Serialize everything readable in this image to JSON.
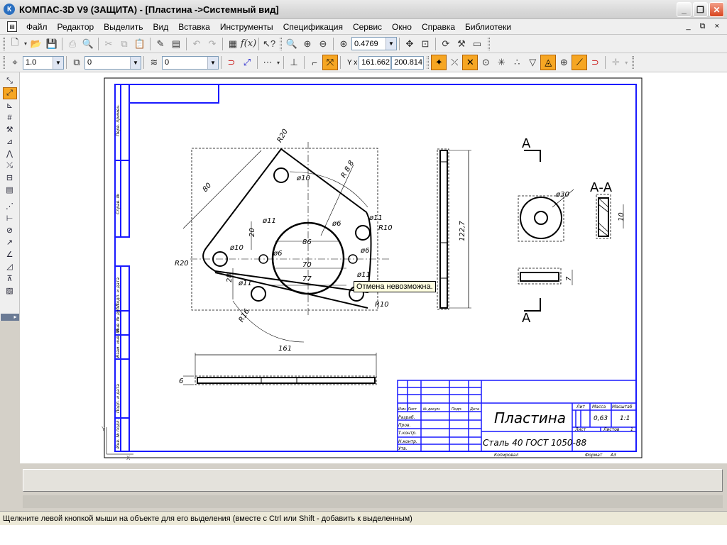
{
  "window": {
    "title": "КОМПАС-3D V9 (ЗАЩИТА) - [Пластина ->Системный вид]",
    "app_icon": "kompas-logo",
    "controls": [
      "minimize",
      "maximize",
      "close"
    ]
  },
  "menu": {
    "items": [
      "Файл",
      "Редактор",
      "Выделить",
      "Вид",
      "Вставка",
      "Инструменты",
      "Спецификация",
      "Сервис",
      "Окно",
      "Справка",
      "Библиотеки"
    ],
    "mdi_controls": "_ ⧉ ×"
  },
  "toolbar_standard": {
    "zoom_value": "0.4769"
  },
  "toolbar_current_state": {
    "step_value": "1.0",
    "layer_value": "0",
    "view_value": "0",
    "coord_label": "Y x",
    "coord_x": "161.662",
    "coord_y": "200.814"
  },
  "tooltip": "Отмена невозможна.",
  "status_text": "Щелкните левой кнопкой мыши на объекте для его выделения (вместе с Ctrl или Shift - добавить к выделенным)",
  "drawing": {
    "dims": {
      "r20_top": "R20",
      "d10_top": "ø10",
      "dim80": "80",
      "r88": "R 8 8",
      "d20": "20",
      "d11a": "ø11",
      "d10b": "ø10",
      "d86": "86",
      "d6a": "ø6",
      "d6b": "ø6",
      "d6c": "ø6",
      "d11b": "ø11",
      "r10_right": "R10",
      "r20_left": "R20",
      "d70": "70",
      "d77": "77",
      "d28": "28",
      "d11c": "ø11",
      "d11d": "ø11",
      "r10_br": "R10",
      "r16": "R16",
      "d161": "161",
      "d6_thick": "6",
      "d122": "122,7",
      "sec_label": "А",
      "sec_label2": "А",
      "section_title": "А-А",
      "d30": "ø30",
      "d10_sec": "10",
      "d7": "7"
    },
    "side_stamp": [
      "Перв. примен.",
      "Справ. №",
      "Подп. и дата",
      "Инв. № дубл.",
      "Взам. инв. №",
      "Подп. и дата",
      "Инв. № подл."
    ],
    "title_block": {
      "name": "Пластина",
      "material": "Сталь 40  ГОСТ 1050-88",
      "col_lit": "Лит",
      "col_mass": "Масса",
      "col_scale": "Масштаб",
      "mass": "0,63",
      "scale": "1:1",
      "sheet": "Лист",
      "sheets": "Листов",
      "sheets_count": "1",
      "rows": [
        "Изм. Лист",
        "№ докум.",
        "Подп.",
        "Дата"
      ],
      "roles": [
        "Разраб.",
        "Пров.",
        "Т.контр.",
        "",
        "Н.контр.",
        "Утв."
      ],
      "copied": "Копировал",
      "format": "Формат",
      "format_value": "А3"
    }
  }
}
